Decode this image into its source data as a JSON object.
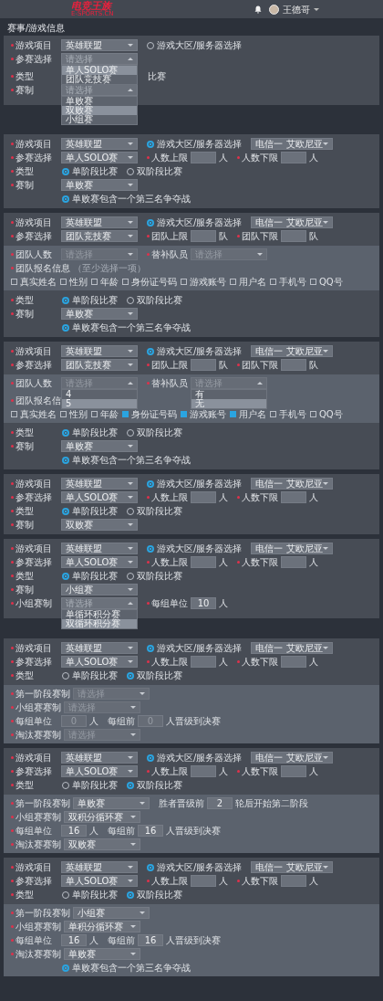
{
  "header": {
    "logo_title": "电竞王族",
    "logo_subtitle": "E-SPORTS.CN",
    "user_name": "王德哥"
  },
  "breadcrumb": "赛事/游戏信息",
  "panels": [
    {
      "sections": [
        {
          "shaded": false,
          "rows": [
            [
              {
                "kind": "select",
                "label": "游戏项目",
                "required": true,
                "value": "英雄联盟"
              },
              {
                "kind": "radio",
                "label": "游戏大区/服务器选择",
                "selected": false
              }
            ],
            [
              {
                "kind": "select",
                "label": "参赛选择",
                "required": true,
                "placeholder": "请选择",
                "open": [
                  {
                    "label": "单人SOLO赛",
                    "selected": true
                  },
                  {
                    "label": "团队竞技赛",
                    "selected": false
                  }
                ]
              }
            ],
            [
              {
                "kind": "label",
                "label": "类型",
                "required": true
              },
              {
                "kind": "text",
                "text": "比赛"
              }
            ],
            [
              {
                "kind": "select",
                "label": "赛制",
                "required": true,
                "placeholder": "请选择",
                "open": [
                  {
                    "label": "单败赛",
                    "selected": false
                  },
                  {
                    "label": "双败赛",
                    "selected": true
                  },
                  {
                    "label": "小组赛",
                    "selected": false
                  }
                ]
              }
            ]
          ]
        }
      ]
    },
    {
      "sections": [
        {
          "shaded": false,
          "rows": [
            [
              {
                "kind": "select",
                "label": "游戏项目",
                "required": true,
                "value": "英雄联盟"
              },
              {
                "kind": "radio",
                "label": "游戏大区/服务器选择",
                "selected": true
              },
              {
                "kind": "select",
                "value": "电信一 艾欧尼亚"
              }
            ],
            [
              {
                "kind": "select",
                "label": "参赛选择",
                "required": true,
                "value": "单人SOLO赛"
              },
              {
                "kind": "number",
                "label": "人数上限",
                "required": true,
                "unit": "人"
              },
              {
                "kind": "number",
                "label": "人数下限",
                "required": true,
                "unit": "人"
              }
            ],
            [
              {
                "kind": "radios",
                "label": "类型",
                "required": true,
                "options": [
                  {
                    "label": "单阶段比赛",
                    "selected": true
                  },
                  {
                    "label": "双阶段比赛",
                    "selected": false
                  }
                ]
              }
            ],
            [
              {
                "kind": "select",
                "label": "赛制",
                "required": true,
                "value": "单败赛"
              }
            ],
            [
              {
                "kind": "option",
                "label": "单败赛包含一个第三名争夺战",
                "selected": true
              }
            ]
          ]
        }
      ]
    },
    {
      "sections": [
        {
          "shaded": false,
          "rows": [
            [
              {
                "kind": "select",
                "label": "游戏项目",
                "required": true,
                "value": "英雄联盟"
              },
              {
                "kind": "radio",
                "label": "游戏大区/服务器选择",
                "selected": true
              },
              {
                "kind": "select",
                "value": "电信一 艾欧尼亚"
              }
            ],
            [
              {
                "kind": "select",
                "label": "参赛选择",
                "required": true,
                "value": "团队竞技赛"
              },
              {
                "kind": "number",
                "label": "团队上限",
                "required": true,
                "unit": "队"
              },
              {
                "kind": "number",
                "label": "团队下限",
                "required": true,
                "unit": "队"
              }
            ]
          ]
        },
        {
          "shaded": true,
          "rows": [
            [
              {
                "kind": "select",
                "label": "团队人数",
                "required": true,
                "placeholder": "请选择",
                "disabled": true
              },
              {
                "kind": "select",
                "label": "替补队员",
                "required": true,
                "placeholder": "请选择",
                "disabled": true
              }
            ],
            [
              {
                "kind": "label",
                "label": "团队报名信息",
                "required": true,
                "note": "（至少选择一项）"
              }
            ],
            [
              {
                "kind": "checks",
                "options": [
                  {
                    "label": "真实姓名",
                    "checked": false
                  },
                  {
                    "label": "性别",
                    "checked": false
                  },
                  {
                    "label": "年龄",
                    "checked": false
                  },
                  {
                    "label": "身份证号码",
                    "checked": false
                  },
                  {
                    "label": "游戏账号",
                    "checked": false
                  },
                  {
                    "label": "用户名",
                    "checked": false
                  },
                  {
                    "label": "手机号",
                    "checked": false
                  },
                  {
                    "label": "QQ号",
                    "checked": false
                  }
                ]
              }
            ]
          ]
        },
        {
          "shaded": false,
          "rows": [
            [
              {
                "kind": "radios",
                "label": "类型",
                "required": true,
                "options": [
                  {
                    "label": "单阶段比赛",
                    "selected": true
                  },
                  {
                    "label": "双阶段比赛",
                    "selected": false
                  }
                ]
              }
            ],
            [
              {
                "kind": "select",
                "label": "赛制",
                "required": true,
                "value": "单败赛"
              }
            ],
            [
              {
                "kind": "option",
                "label": "单败赛包含一个第三名争夺战",
                "selected": true
              }
            ]
          ]
        }
      ]
    },
    {
      "sections": [
        {
          "shaded": false,
          "rows": [
            [
              {
                "kind": "select",
                "label": "游戏项目",
                "required": true,
                "value": "英雄联盟"
              },
              {
                "kind": "radio",
                "label": "游戏大区/服务器选择",
                "selected": true
              },
              {
                "kind": "select",
                "value": "电信一 艾欧尼亚"
              }
            ],
            [
              {
                "kind": "select",
                "label": "参赛选择",
                "required": true,
                "value": "团队竞技赛"
              },
              {
                "kind": "number",
                "label": "团队上限",
                "required": true,
                "unit": "队"
              },
              {
                "kind": "number",
                "label": "团队下限",
                "required": true,
                "unit": "队"
              }
            ]
          ]
        },
        {
          "shaded": true,
          "rows": [
            [
              {
                "kind": "select",
                "label": "团队人数",
                "required": true,
                "placeholder": "请选择",
                "disabled": true,
                "open": [
                  {
                    "label": "4",
                    "selected": false
                  },
                  {
                    "label": "5",
                    "selected": true
                  }
                ]
              },
              {
                "kind": "select",
                "label": "替补队员",
                "required": true,
                "placeholder": "请选择",
                "disabled": true,
                "open": [
                  {
                    "label": "有",
                    "selected": false
                  },
                  {
                    "label": "无",
                    "selected": true
                  }
                ]
              }
            ],
            [
              {
                "kind": "label",
                "label": "团队报名信",
                "required": true
              }
            ],
            [
              {
                "kind": "checks",
                "options": [
                  {
                    "label": "真实姓名",
                    "checked": false
                  },
                  {
                    "label": "性别",
                    "checked": false
                  },
                  {
                    "label": "年龄",
                    "checked": false
                  },
                  {
                    "label": "身份证号码",
                    "checked": true
                  },
                  {
                    "label": "游戏账号",
                    "checked": true
                  },
                  {
                    "label": "用户名",
                    "checked": true
                  },
                  {
                    "label": "手机号",
                    "checked": false
                  },
                  {
                    "label": "QQ号",
                    "checked": false
                  }
                ]
              }
            ]
          ]
        },
        {
          "shaded": false,
          "rows": [
            [
              {
                "kind": "radios",
                "label": "类型",
                "required": true,
                "options": [
                  {
                    "label": "单阶段比赛",
                    "selected": true
                  },
                  {
                    "label": "双阶段比赛",
                    "selected": false
                  }
                ]
              }
            ],
            [
              {
                "kind": "select",
                "label": "赛制",
                "required": true,
                "value": "单败赛"
              }
            ],
            [
              {
                "kind": "option",
                "label": "单败赛包含一个第三名争夺战",
                "selected": true
              }
            ]
          ]
        }
      ]
    },
    {
      "sections": [
        {
          "shaded": false,
          "rows": [
            [
              {
                "kind": "select",
                "label": "游戏项目",
                "required": true,
                "value": "英雄联盟"
              },
              {
                "kind": "radio",
                "label": "游戏大区/服务器选择",
                "selected": true
              },
              {
                "kind": "select",
                "value": "电信一 艾欧尼亚"
              }
            ],
            [
              {
                "kind": "select",
                "label": "参赛选择",
                "required": true,
                "value": "单人SOLO赛"
              },
              {
                "kind": "number",
                "label": "人数上限",
                "required": true,
                "unit": "人"
              },
              {
                "kind": "number",
                "label": "人数下限",
                "required": true,
                "unit": "人"
              }
            ],
            [
              {
                "kind": "radios",
                "label": "类型",
                "required": true,
                "options": [
                  {
                    "label": "单阶段比赛",
                    "selected": true
                  },
                  {
                    "label": "双阶段比赛",
                    "selected": false
                  }
                ]
              }
            ],
            [
              {
                "kind": "select",
                "label": "赛制",
                "required": true,
                "value": "双败赛"
              }
            ]
          ]
        }
      ]
    },
    {
      "sections": [
        {
          "shaded": false,
          "rows": [
            [
              {
                "kind": "select",
                "label": "游戏项目",
                "required": true,
                "value": "英雄联盟"
              },
              {
                "kind": "radio",
                "label": "游戏大区/服务器选择",
                "selected": true
              },
              {
                "kind": "select",
                "value": "电信一 艾欧尼亚"
              }
            ],
            [
              {
                "kind": "select",
                "label": "参赛选择",
                "required": true,
                "value": "单人SOLO赛"
              },
              {
                "kind": "number",
                "label": "人数上限",
                "required": true,
                "unit": "人"
              },
              {
                "kind": "number",
                "label": "人数下限",
                "required": true,
                "unit": "人"
              }
            ],
            [
              {
                "kind": "radios",
                "label": "类型",
                "required": true,
                "options": [
                  {
                    "label": "单阶段比赛",
                    "selected": true
                  },
                  {
                    "label": "双阶段比赛",
                    "selected": false
                  }
                ]
              }
            ],
            [
              {
                "kind": "select",
                "label": "赛制",
                "required": true,
                "value": "小组赛"
              }
            ],
            [
              {
                "kind": "select",
                "label": "小组赛制",
                "required": true,
                "placeholder": "请选择",
                "open": [
                  {
                    "label": "单循环积分赛",
                    "selected": false
                  },
                  {
                    "label": "双循环积分赛",
                    "selected": true
                  }
                ]
              },
              {
                "kind": "number",
                "label": "每组单位",
                "required": true,
                "value": "10",
                "unit": "人"
              }
            ]
          ]
        }
      ]
    },
    {
      "sections": [
        {
          "shaded": false,
          "rows": [
            [
              {
                "kind": "select",
                "label": "游戏项目",
                "required": true,
                "value": "英雄联盟"
              },
              {
                "kind": "radio",
                "label": "游戏大区/服务器选择",
                "selected": true
              },
              {
                "kind": "select",
                "value": "电信一 艾欧尼亚"
              }
            ],
            [
              {
                "kind": "select",
                "label": "参赛选择",
                "required": true,
                "value": "单人SOLO赛"
              },
              {
                "kind": "number",
                "label": "人数上限",
                "required": true,
                "unit": "人"
              },
              {
                "kind": "number",
                "label": "人数下限",
                "required": true,
                "unit": "人"
              }
            ],
            [
              {
                "kind": "radios",
                "label": "类型",
                "required": true,
                "options": [
                  {
                    "label": "单阶段比赛",
                    "selected": false
                  },
                  {
                    "label": "双阶段比赛",
                    "selected": true
                  }
                ]
              }
            ]
          ]
        },
        {
          "shaded": true,
          "rows": [
            [
              {
                "kind": "select",
                "label": "第一阶段赛制",
                "required": true,
                "placeholder": "请选择",
                "disabled": true
              }
            ],
            [
              {
                "kind": "select",
                "label": "小组赛赛制",
                "required": true,
                "placeholder": "请选择",
                "disabled": true
              }
            ],
            [
              {
                "kind": "number",
                "label": "每组单位",
                "required": true,
                "placeholder": "0",
                "unit": "人",
                "disabled": true
              },
              {
                "kind": "number",
                "label": "每组前",
                "placeholder": "0",
                "unit": "人晋级到决赛",
                "disabled": true
              }
            ],
            [
              {
                "kind": "select",
                "label": "淘汰赛赛制",
                "required": true,
                "placeholder": "请选择",
                "disabled": true
              }
            ]
          ]
        }
      ]
    },
    {
      "sections": [
        {
          "shaded": false,
          "rows": [
            [
              {
                "kind": "select",
                "label": "游戏项目",
                "required": true,
                "value": "英雄联盟"
              },
              {
                "kind": "radio",
                "label": "游戏大区/服务器选择",
                "selected": true
              },
              {
                "kind": "select",
                "value": "电信一 艾欧尼亚"
              }
            ],
            [
              {
                "kind": "select",
                "label": "参赛选择",
                "required": true,
                "value": "单人SOLO赛"
              },
              {
                "kind": "number",
                "label": "人数上限",
                "required": true,
                "unit": "人"
              },
              {
                "kind": "number",
                "label": "人数下限",
                "required": true,
                "unit": "人"
              }
            ],
            [
              {
                "kind": "radios",
                "label": "类型",
                "required": true,
                "options": [
                  {
                    "label": "单阶段比赛",
                    "selected": false
                  },
                  {
                    "label": "双阶段比赛",
                    "selected": true
                  }
                ]
              }
            ]
          ]
        },
        {
          "shaded": true,
          "rows": [
            [
              {
                "kind": "select",
                "label": "第一阶段赛制",
                "required": true,
                "value": "单败赛"
              },
              {
                "kind": "number",
                "label": "胜者晋级前",
                "value": "2",
                "unit": "轮后开始第二阶段"
              }
            ],
            [
              {
                "kind": "select",
                "label": "小组赛赛制",
                "required": true,
                "value": "双积分循环赛"
              }
            ],
            [
              {
                "kind": "number",
                "label": "每组单位",
                "required": true,
                "value": "16",
                "unit": "人"
              },
              {
                "kind": "number",
                "label": "每组前",
                "value": "16",
                "unit": "人晋级到决赛"
              }
            ],
            [
              {
                "kind": "select",
                "label": "淘汰赛赛制",
                "required": true,
                "value": "双败赛"
              }
            ]
          ]
        }
      ]
    },
    {
      "sections": [
        {
          "shaded": false,
          "rows": [
            [
              {
                "kind": "select",
                "label": "游戏项目",
                "required": true,
                "value": "英雄联盟"
              },
              {
                "kind": "radio",
                "label": "游戏大区/服务器选择",
                "selected": true
              },
              {
                "kind": "select",
                "value": "电信一 艾欧尼亚"
              }
            ],
            [
              {
                "kind": "select",
                "label": "参赛选择",
                "required": true,
                "value": "单人SOLO赛"
              },
              {
                "kind": "number",
                "label": "人数上限",
                "required": true,
                "unit": "人"
              },
              {
                "kind": "number",
                "label": "人数下限",
                "required": true,
                "unit": "人"
              }
            ],
            [
              {
                "kind": "radios",
                "label": "类型",
                "required": true,
                "options": [
                  {
                    "label": "单阶段比赛",
                    "selected": false
                  },
                  {
                    "label": "双阶段比赛",
                    "selected": true
                  }
                ]
              }
            ]
          ]
        },
        {
          "shaded": true,
          "rows": [
            [
              {
                "kind": "select",
                "label": "第一阶段赛制",
                "required": true,
                "value": "小组赛"
              }
            ],
            [
              {
                "kind": "select",
                "label": "小组赛赛制",
                "required": true,
                "value": "单积分循环赛"
              }
            ],
            [
              {
                "kind": "number",
                "label": "每组单位",
                "required": true,
                "value": "16",
                "unit": "人"
              },
              {
                "kind": "number",
                "label": "每组前",
                "value": "16",
                "unit": "人晋级到决赛"
              }
            ],
            [
              {
                "kind": "select",
                "label": "淘汰赛赛制",
                "required": true,
                "value": "单败赛"
              }
            ],
            [
              {
                "kind": "option",
                "label": "单败赛包含一个第三名争夺战",
                "selected": true
              }
            ]
          ]
        }
      ]
    }
  ]
}
